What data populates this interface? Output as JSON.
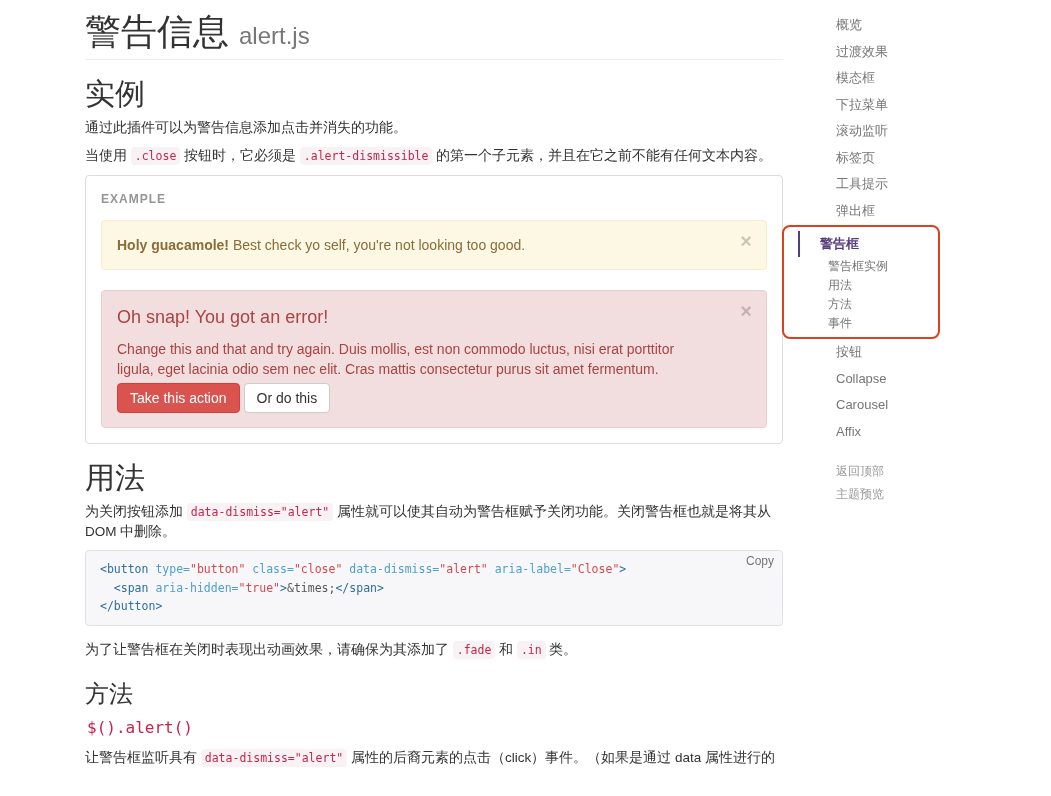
{
  "title": {
    "main": "警告信息",
    "sub": "alert.js"
  },
  "blocks": [
    {
      "kind": "heading",
      "text": "实例"
    },
    {
      "kind": "paragraph",
      "segments": [
        {
          "kind": "text",
          "text": "通过此插件可以为警告信息添加点击并消失的功能。"
        }
      ]
    },
    {
      "kind": "paragraph",
      "segments": [
        {
          "kind": "text",
          "text": "当使用 "
        },
        {
          "kind": "code",
          "text": ".close"
        },
        {
          "kind": "text",
          "text": " 按钮时，它必须是 "
        },
        {
          "kind": "code",
          "text": ".alert-dismissible"
        },
        {
          "kind": "text",
          "text": " 的第一个子元素，并且在它之前不能有任何文本内容。"
        }
      ]
    },
    {
      "kind": "example",
      "label": "EXAMPLE",
      "alerts": [
        {
          "kind": "warning",
          "text": "**Holy guacamole!** Best check yo self, you're not looking too good.",
          "close": "×"
        },
        {
          "kind": "danger",
          "heading": "Oh snap! You got an error!",
          "text": "Change this and that and try again. Duis mollis, est non commodo luctus, nisi erat porttitor ligula, eget lacinia odio sem nec elit. Cras mattis consectetur purus sit amet fermentum.",
          "close": "×",
          "buttons": [
            {
              "label": "Take this action",
              "kind": "danger"
            },
            {
              "label": "Or do this",
              "kind": "default"
            }
          ]
        }
      ]
    },
    {
      "kind": "heading",
      "text": "用法"
    },
    {
      "kind": "paragraph",
      "segments": [
        {
          "kind": "text",
          "text": "为关闭按钮添加 "
        },
        {
          "kind": "code",
          "text": "data-dismiss=\"alert\""
        },
        {
          "kind": "text",
          "text": " 属性就可以使其自动为警告框赋予关闭功能。关闭警告框也就是将其从 DOM 中删除。"
        }
      ]
    },
    {
      "kind": "code",
      "copy": "Copy",
      "lines": [
        [
          {
            "kind": "tag",
            "text": "<button"
          },
          {
            "kind": "attr",
            "text": " type="
          },
          {
            "kind": "string",
            "text": "\"button\""
          },
          {
            "kind": "attr",
            "text": " class="
          },
          {
            "kind": "string",
            "text": "\"close\""
          },
          {
            "kind": "attr",
            "text": " data-dismiss="
          },
          {
            "kind": "string",
            "text": "\"alert\""
          },
          {
            "kind": "attr",
            "text": " aria-label="
          },
          {
            "kind": "string",
            "text": "\"Close\""
          },
          {
            "kind": "tag",
            "text": ">"
          }
        ],
        [
          {
            "kind": "tag",
            "text": "  <span"
          },
          {
            "kind": "attr",
            "text": " aria-hidden="
          },
          {
            "kind": "string",
            "text": "\"true\""
          },
          {
            "kind": "tag",
            "text": ">"
          },
          {
            "kind": "plain",
            "text": "&times;"
          },
          {
            "kind": "tag",
            "text": "</span>"
          }
        ],
        [
          {
            "kind": "tag",
            "text": "</button>"
          }
        ]
      ]
    },
    {
      "kind": "paragraph",
      "segments": [
        {
          "kind": "text",
          "text": "为了让警告框在关闭时表现出动画效果，请确保为其添加了 "
        },
        {
          "kind": "code",
          "text": ".fade"
        },
        {
          "kind": "text",
          "text": " 和 "
        },
        {
          "kind": "code",
          "text": ".in"
        },
        {
          "kind": "text",
          "text": " 类。"
        }
      ]
    },
    {
      "kind": "subheading",
      "text": "方法"
    },
    {
      "kind": "method",
      "text": "$().alert()"
    },
    {
      "kind": "paragraph",
      "segments": [
        {
          "kind": "text",
          "text": "让警告框监听具有 "
        },
        {
          "kind": "code",
          "text": "data-dismiss=\"alert\""
        },
        {
          "kind": "text",
          "text": " 属性的后裔元素的点击（click）事件。（如果是通过 data 属性进行的"
        }
      ]
    }
  ],
  "sidebar": {
    "items": [
      {
        "label": "概览",
        "selected": false
      },
      {
        "label": "过渡效果",
        "selected": false
      },
      {
        "label": "模态框",
        "selected": false
      },
      {
        "label": "下拉菜单",
        "selected": false
      },
      {
        "label": "滚动监听",
        "selected": false
      },
      {
        "label": "标签页",
        "selected": false
      },
      {
        "label": "工具提示",
        "selected": false
      },
      {
        "label": "弹出框",
        "selected": false
      },
      {
        "label": "警告框",
        "selected": true,
        "highlighted": true,
        "children": [
          {
            "label": "警告框实例"
          },
          {
            "label": "用法"
          },
          {
            "label": "方法"
          },
          {
            "label": "事件"
          }
        ]
      },
      {
        "label": "按钮",
        "selected": false
      },
      {
        "label": "Collapse",
        "selected": false
      },
      {
        "label": "Carousel",
        "selected": false
      },
      {
        "label": "Affix",
        "selected": false
      }
    ],
    "footer_links": [
      "返回顶部",
      "主题预览"
    ]
  }
}
